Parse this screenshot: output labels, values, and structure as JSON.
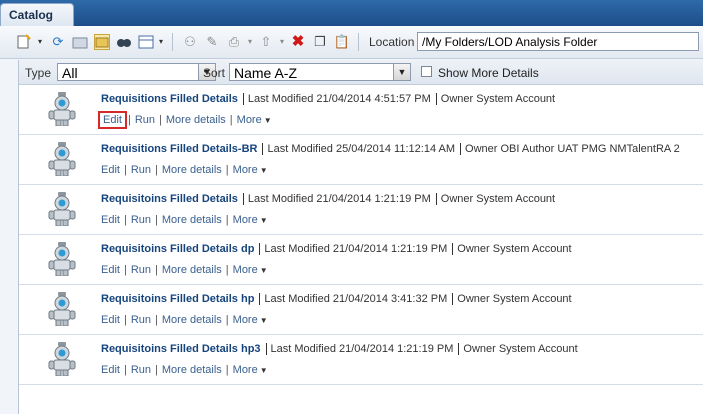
{
  "tab": {
    "label": "Catalog"
  },
  "toolbar": {
    "location_label": "Location",
    "location_value": "/My Folders/LOD Analysis Folder"
  },
  "filter": {
    "type_label": "Type",
    "type_value": "All",
    "sort_label": "Sort",
    "sort_value": "Name A-Z",
    "show_more_label": "Show More Details"
  },
  "items": [
    {
      "name": "Requisitions Filled Details",
      "modified": "Last Modified 21/04/2014 4:51:57 PM",
      "owner": "Owner System Account",
      "edit": "Edit",
      "run": "Run",
      "more_details": "More details",
      "more": "More"
    },
    {
      "name": "Requisitions Filled Details-BR",
      "modified": "Last Modified 25/04/2014 11:12:14 AM",
      "owner": "Owner OBI Author UAT PMG NMTalentRA 2",
      "edit": "Edit",
      "run": "Run",
      "more_details": "More details",
      "more": "More"
    },
    {
      "name": "Requisitoins Filled Details",
      "modified": "Last Modified 21/04/2014 1:21:19 PM",
      "owner": "Owner System Account",
      "edit": "Edit",
      "run": "Run",
      "more_details": "More details",
      "more": "More"
    },
    {
      "name": "Requisitoins Filled Details dp",
      "modified": "Last Modified 21/04/2014 1:21:19 PM",
      "owner": "Owner System Account",
      "edit": "Edit",
      "run": "Run",
      "more_details": "More details",
      "more": "More"
    },
    {
      "name": "Requisitoins Filled Details hp",
      "modified": "Last Modified 21/04/2014 3:41:32 PM",
      "owner": "Owner System Account",
      "edit": "Edit",
      "run": "Run",
      "more_details": "More details",
      "more": "More"
    },
    {
      "name": "Requisitoins Filled Details hp3",
      "modified": "Last Modified 21/04/2014 1:21:19 PM",
      "owner": "Owner System Account",
      "edit": "Edit",
      "run": "Run",
      "more_details": "More details",
      "more": "More"
    }
  ],
  "colors": {
    "highlight": "#d62828",
    "link": "#16447d",
    "brand": "#1f4f8a"
  }
}
